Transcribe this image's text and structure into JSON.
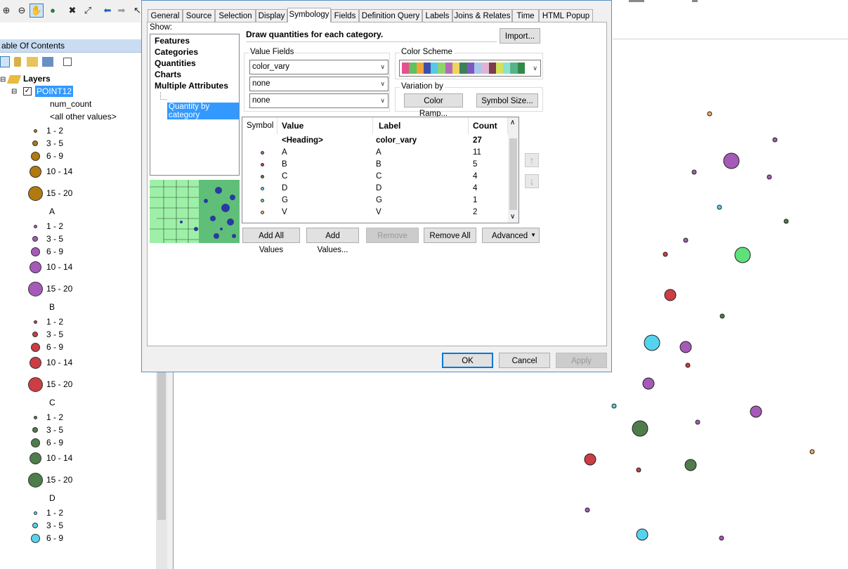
{
  "toolbar": {
    "icons": [
      "zoom-in-icon",
      "zoom-out-icon",
      "pan-icon",
      "globe-icon",
      "full-extent-icon",
      "fixed-zoom-icon",
      "back-icon",
      "forward-icon",
      "select-icon"
    ]
  },
  "toc": {
    "title": "able Of Contents",
    "root_label": "Layers",
    "layer_label": "POINT12",
    "field_label": "num_count",
    "other_values_label": "<all other values>",
    "groups": [
      {
        "name": "",
        "color": "#b07a0f",
        "ranges": [
          "1 - 2",
          "3 - 5",
          "6 - 9",
          "10 - 14",
          "15 - 20"
        ]
      },
      {
        "name": "A",
        "color": "#a65ab8",
        "ranges": [
          "1 - 2",
          "3 - 5",
          "6 - 9",
          "10 - 14",
          "15 - 20"
        ]
      },
      {
        "name": "B",
        "color": "#cc3d44",
        "ranges": [
          "1 - 2",
          "3 - 5",
          "6 - 9",
          "10 - 14",
          "15 - 20"
        ]
      },
      {
        "name": "C",
        "color": "#4e7d4c",
        "ranges": [
          "1 - 2",
          "3 - 5",
          "6 - 9",
          "10 - 14",
          "15 - 20"
        ]
      },
      {
        "name": "D",
        "color": "#55d3ee",
        "ranges": [
          "1 - 2",
          "3 - 5",
          "6 - 9"
        ]
      }
    ]
  },
  "dialog": {
    "tabs": [
      "General",
      "Source",
      "Selection",
      "Display",
      "Symbology",
      "Fields",
      "Definition Query",
      "Labels",
      "Joins & Relates",
      "Time",
      "HTML Popup"
    ],
    "selected_tab": "Symbology",
    "show_label": "Show:",
    "show_items": [
      "Features",
      "Categories",
      "Quantities",
      "Charts",
      "Multiple Attributes"
    ],
    "show_selected_sub": "Quantity by category",
    "description": "Draw quantities for each category.",
    "import_label": "Import...",
    "value_fields_title": "Value Fields",
    "value_fields": [
      "color_vary",
      "none",
      "none"
    ],
    "color_scheme_title": "Color Scheme",
    "color_scheme_colors": [
      "#e6508e",
      "#5fc25e",
      "#f3a33a",
      "#3e4fa8",
      "#56c9e6",
      "#8fd46a",
      "#b56ab8",
      "#f0d35a",
      "#3d7f5a",
      "#7e58c2",
      "#a7c8ea",
      "#e2b3d3",
      "#7a3f4a",
      "#d4e25a",
      "#8ae2d0",
      "#56b38a",
      "#2e8a46"
    ],
    "variation_title": "Variation by",
    "color_ramp_label": "Color Ramp...",
    "symbol_size_label": "Symbol Size...",
    "grid_headers": {
      "symbol": "Symbol",
      "value": "Value",
      "label": "Label",
      "count": "Count"
    },
    "heading_row": {
      "value": "<Heading>",
      "label": "color_vary",
      "count": "27"
    },
    "rows": [
      {
        "value": "A",
        "label": "A",
        "count": "11",
        "color": "#a65ab8"
      },
      {
        "value": "B",
        "label": "B",
        "count": "5",
        "color": "#cc3d44"
      },
      {
        "value": "C",
        "label": "C",
        "count": "4",
        "color": "#4e7d4c"
      },
      {
        "value": "D",
        "label": "D",
        "count": "4",
        "color": "#55d3ee"
      },
      {
        "value": "G",
        "label": "G",
        "count": "1",
        "color": "#5ee07a"
      },
      {
        "value": "V",
        "label": "V",
        "count": "2",
        "color": "#f0a860"
      }
    ],
    "add_all_values_label": "Add All Values",
    "add_values_label": "Add Values...",
    "remove_label": "Remove",
    "remove_all_label": "Remove All",
    "advanced_label": "Advanced",
    "ok_label": "OK",
    "cancel_label": "Cancel",
    "apply_label": "Apply"
  },
  "map": {
    "points": [
      {
        "color": "#f0a860",
        "size": "small"
      },
      {
        "color": "#a65ab8",
        "size": "small"
      },
      {
        "color": "#a65ab8",
        "size": "large"
      },
      {
        "color": "#a65ab8",
        "size": "small"
      },
      {
        "color": "#a65ab8",
        "size": "small"
      },
      {
        "color": "#55d3ee",
        "size": "small"
      },
      {
        "color": "#4e7d4c",
        "size": "small"
      },
      {
        "color": "#a65ab8",
        "size": "small"
      },
      {
        "color": "#cc3d44",
        "size": "small"
      },
      {
        "color": "#5ee07a",
        "size": "large"
      },
      {
        "color": "#cc3d44",
        "size": "medium"
      },
      {
        "color": "#4e7d4c",
        "size": "small"
      },
      {
        "color": "#55d3ee",
        "size": "large"
      },
      {
        "color": "#a65ab8",
        "size": "medium"
      },
      {
        "color": "#cc3d44",
        "size": "small"
      },
      {
        "color": "#a65ab8",
        "size": "medium"
      },
      {
        "color": "#55d3ee",
        "size": "small"
      },
      {
        "color": "#a65ab8",
        "size": "medium"
      },
      {
        "color": "#4e7d4c",
        "size": "large"
      },
      {
        "color": "#a65ab8",
        "size": "small"
      },
      {
        "color": "#f0a860",
        "size": "small"
      },
      {
        "color": "#cc3d44",
        "size": "medium"
      },
      {
        "color": "#cc3d44",
        "size": "small"
      },
      {
        "color": "#4e7d4c",
        "size": "medium"
      },
      {
        "color": "#a65ab8",
        "size": "small"
      },
      {
        "color": "#55d3ee",
        "size": "medium"
      },
      {
        "color": "#a65ab8",
        "size": "small"
      }
    ]
  }
}
